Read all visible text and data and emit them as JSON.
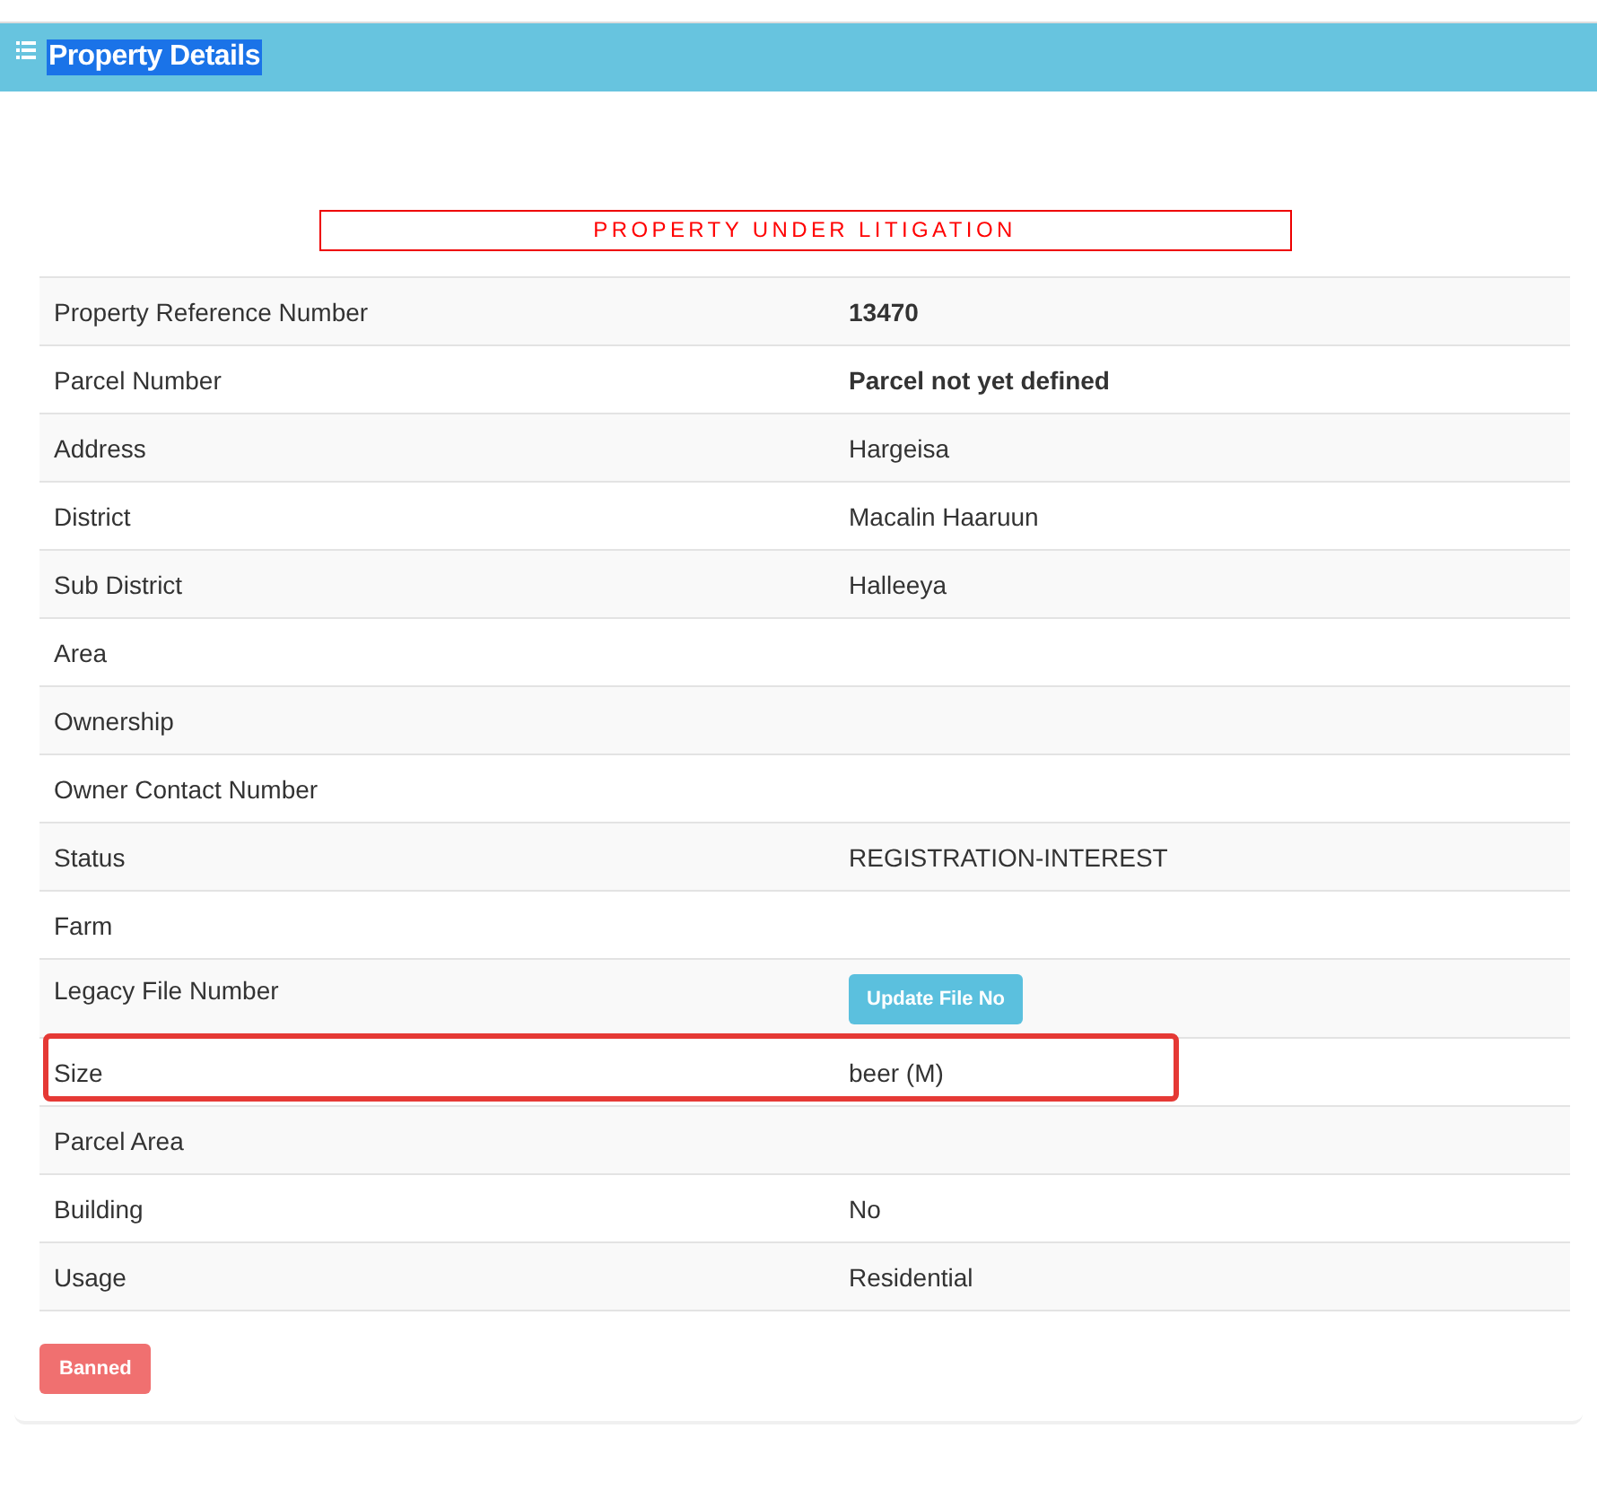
{
  "panel": {
    "title": "Property Details",
    "title_selected": true
  },
  "banner": "PROPERTY UNDER LITIGATION",
  "rows": [
    {
      "label": "Property Reference Number",
      "kind": "bold",
      "value": "13470",
      "highlighted": false
    },
    {
      "label": "Parcel Number",
      "kind": "bold",
      "value": "Parcel not yet defined",
      "highlighted": false
    },
    {
      "label": "Address",
      "kind": "text",
      "value": "Hargeisa",
      "highlighted": false
    },
    {
      "label": "District",
      "kind": "text",
      "value": "Macalin Haaruun",
      "highlighted": false
    },
    {
      "label": "Sub District",
      "kind": "text",
      "value": "Halleeya",
      "highlighted": false
    },
    {
      "label": "Area",
      "kind": "empty",
      "highlighted": false
    },
    {
      "label": "Ownership",
      "kind": "empty",
      "highlighted": false
    },
    {
      "label": "Owner Contact Number",
      "kind": "empty",
      "highlighted": false
    },
    {
      "label": "Status",
      "kind": "text",
      "value": "REGISTRATION-INTEREST",
      "highlighted": false
    },
    {
      "label": "Farm",
      "kind": "empty",
      "highlighted": false
    },
    {
      "label": "Legacy File Number",
      "kind": "button",
      "value": "Update File No",
      "highlighted": false
    },
    {
      "label": "Size",
      "kind": "text",
      "value": "beer (M)",
      "highlighted": true
    },
    {
      "label": "Parcel Area",
      "kind": "empty",
      "highlighted": false
    },
    {
      "label": "Building",
      "kind": "text",
      "value": "No",
      "highlighted": false
    },
    {
      "label": "Usage",
      "kind": "text",
      "value": "Residential",
      "highlighted": false
    }
  ],
  "footer_button": "Banned"
}
